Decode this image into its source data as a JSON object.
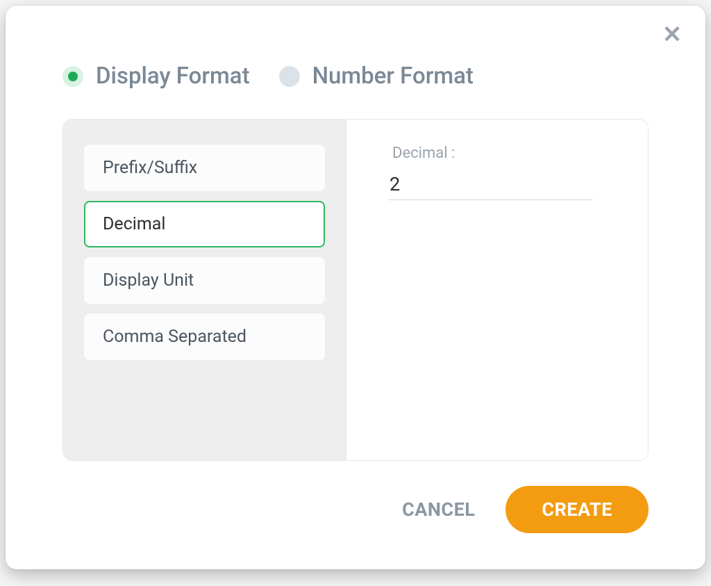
{
  "tabs": {
    "display_format": {
      "label": "Display Format",
      "selected": true
    },
    "number_format": {
      "label": "Number Format",
      "selected": false
    }
  },
  "options": {
    "prefix_suffix": {
      "label": "Prefix/Suffix",
      "active": false
    },
    "decimal": {
      "label": "Decimal",
      "active": true
    },
    "display_unit": {
      "label": "Display Unit",
      "active": false
    },
    "comma_separated": {
      "label": "Comma Separated",
      "active": false
    }
  },
  "form": {
    "decimal_label": "Decimal :",
    "decimal_value": "2"
  },
  "footer": {
    "cancel_label": "CANCEL",
    "create_label": "CREATE"
  },
  "colors": {
    "accent_green": "#2fb85f",
    "accent_orange": "#f39c12",
    "text_muted": "#7a8896"
  }
}
